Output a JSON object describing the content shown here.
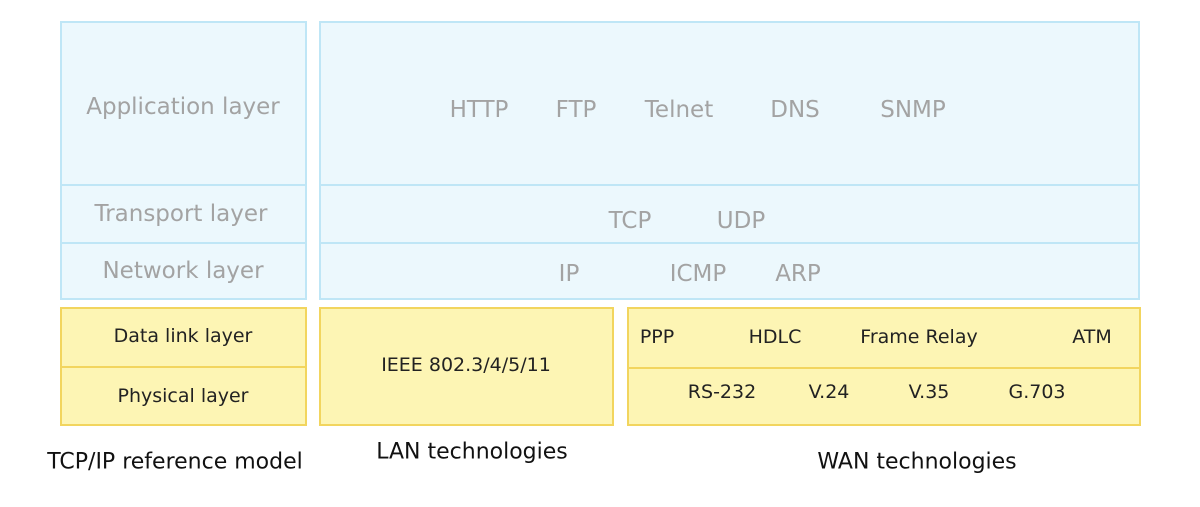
{
  "tcpip": {
    "application": "Application layer",
    "transport": "Transport layer",
    "network": "Network layer",
    "datalink": "Data link layer",
    "physical": "Physical layer",
    "caption": "TCP/IP reference model"
  },
  "protocols": {
    "application": [
      "HTTP",
      "FTP",
      "Telnet",
      "DNS",
      "SNMP"
    ],
    "transport": [
      "TCP",
      "UDP"
    ],
    "network": [
      "IP",
      "ICMP",
      "ARP"
    ]
  },
  "lan": {
    "text": "IEEE 802.3/4/5/11",
    "caption": "LAN technologies"
  },
  "wan": {
    "datalink": [
      "PPP",
      "HDLC",
      "Frame Relay",
      "ATM"
    ],
    "physical": [
      "RS-232",
      "V.24",
      "V.35",
      "G.703"
    ],
    "caption": "WAN technologies"
  },
  "colors": {
    "upper_fill": "#ecf8fd",
    "upper_border": "#bfe6f6",
    "lower_fill": "#fdf5b4",
    "lower_border": "#f2d55e"
  }
}
